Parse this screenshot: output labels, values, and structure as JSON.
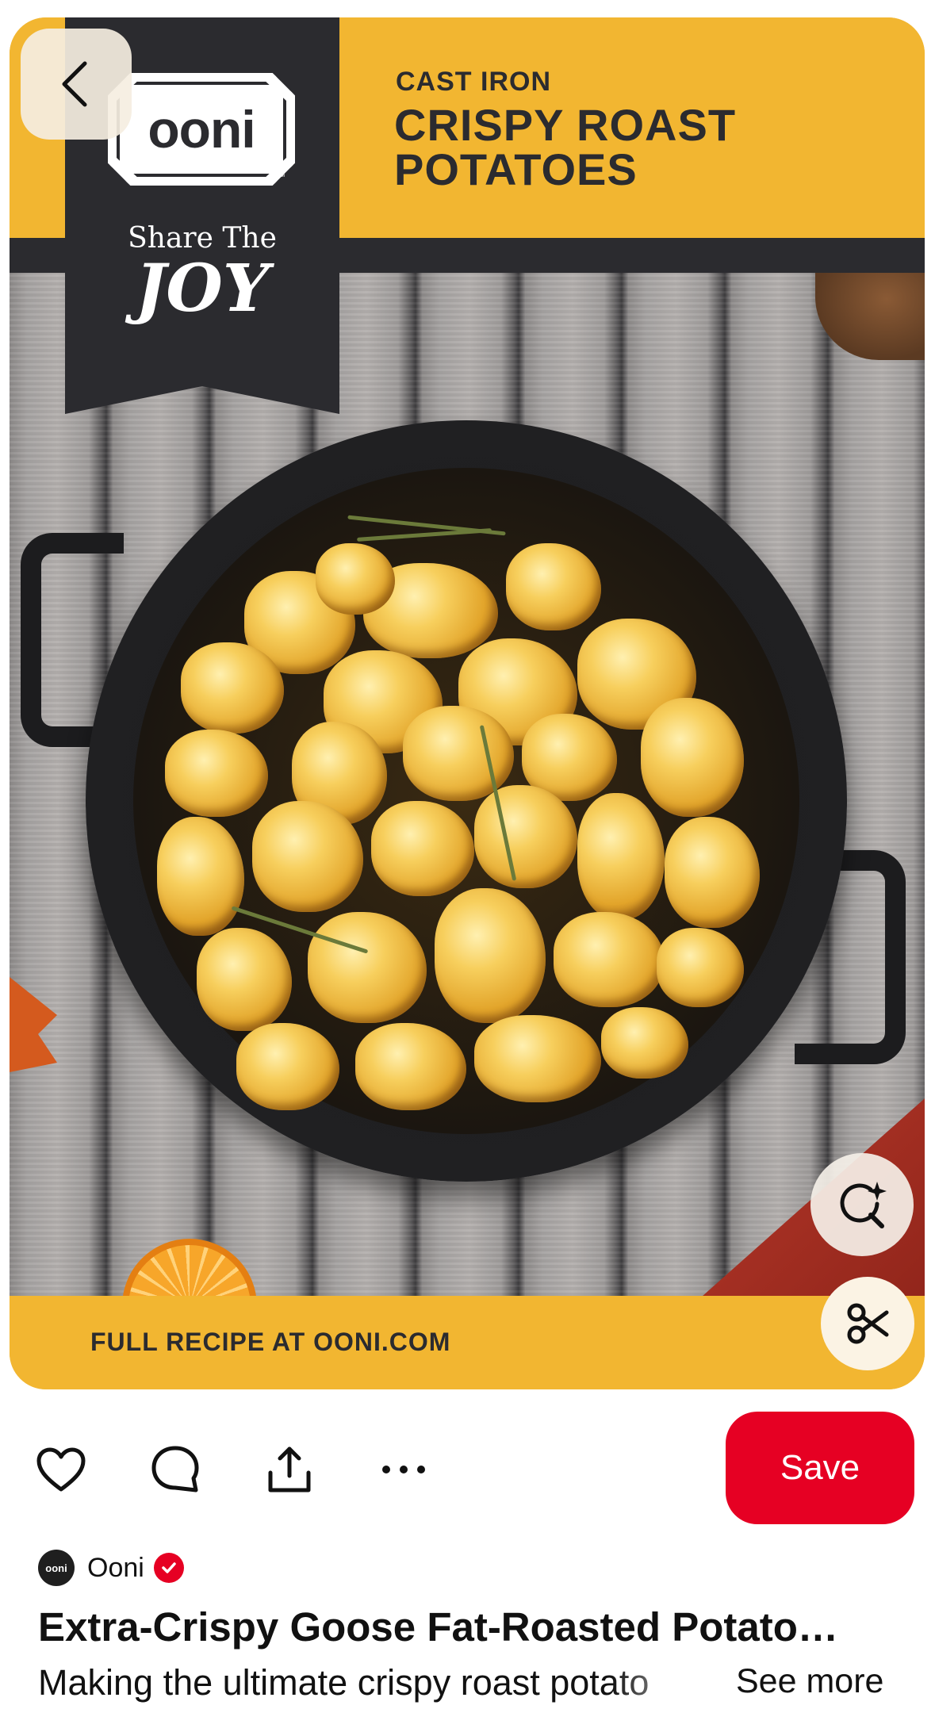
{
  "pin_image": {
    "subtitle": "CAST IRON",
    "title_line1": "CRISPY ROAST",
    "title_line2": "POTATOES",
    "logo_text": "ooni",
    "logo_mark": "™",
    "tagline_top": "Share The",
    "tagline_bottom": "JOY",
    "footer_text": "FULL RECIPE AT OONI.COM"
  },
  "overlay": {
    "back_icon": "chevron-left-icon",
    "lens_icon": "visual-search-sparkle-icon",
    "scissors_icon": "scissors-icon"
  },
  "actions": {
    "like_icon": "heart-icon",
    "comment_icon": "comment-icon",
    "share_icon": "share-icon",
    "more_icon": "more-icon",
    "save_label": "Save"
  },
  "pin": {
    "creator_avatar_text": "ooni",
    "creator_name": "Ooni",
    "title": "Extra-Crispy Goose Fat-Roasted Potato…",
    "description": "Making the ultimate crispy roast potato",
    "see_more_label": "See more"
  },
  "colors": {
    "save_red": "#e60023",
    "brand_yellow": "#f2b631",
    "brand_dark": "#2b2b2f"
  }
}
